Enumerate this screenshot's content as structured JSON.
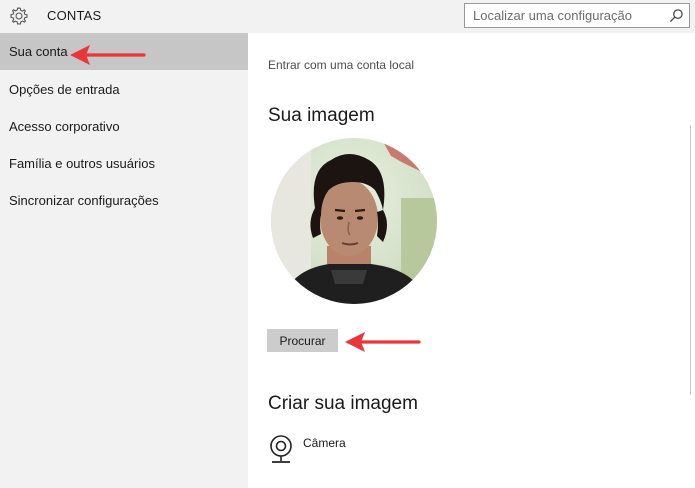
{
  "window": {
    "title": "CONTAS",
    "search_placeholder": "Localizar uma configuração"
  },
  "sidebar": {
    "items": [
      {
        "label": "Sua conta",
        "selected": true
      },
      {
        "label": "Opções de entrada",
        "selected": false
      },
      {
        "label": "Acesso corporativo",
        "selected": false
      },
      {
        "label": "Família e outros usuários",
        "selected": false
      },
      {
        "label": "Sincronizar configurações",
        "selected": false
      }
    ]
  },
  "main": {
    "local_account_link": "Entrar com uma conta local",
    "your_picture_heading": "Sua imagem",
    "browse_button": "Procurar",
    "create_picture_heading": "Criar sua imagem",
    "camera_label": "Câmera"
  },
  "colors": {
    "annotation_arrow": "#e8363a",
    "sidebar_bg": "#f2f2f2",
    "selected_bg": "#c6c6c6",
    "button_bg": "#cccccc"
  },
  "icons": [
    "gear-icon",
    "search-icon",
    "camera-icon"
  ]
}
